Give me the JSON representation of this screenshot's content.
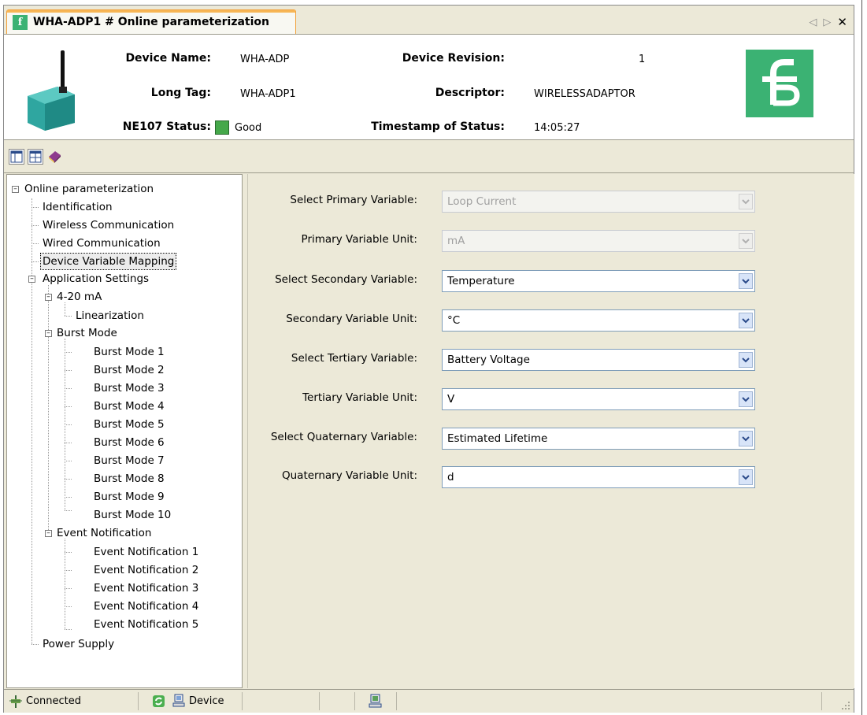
{
  "tab": {
    "title": "WHA-ADP1 # Online parameterization",
    "logo_glyph": "f"
  },
  "header": {
    "device_name_label": "Device Name:",
    "device_name": "WHA-ADP",
    "long_tag_label": "Long Tag:",
    "long_tag": "WHA-ADP1",
    "ne107_label": "NE107 Status:",
    "ne107_value": "Good",
    "device_revision_label": "Device Revision:",
    "device_revision": "1",
    "descriptor_label": "Descriptor:",
    "descriptor": "WIRELESSADAPTOR",
    "timestamp_label": "Timestamp of Status:",
    "timestamp": "14:05:27"
  },
  "tree": {
    "root": "Online parameterization",
    "identification": "Identification",
    "wireless": "Wireless Communication",
    "wired": "Wired Communication",
    "mapping": "Device Variable Mapping",
    "app_settings": "Application Settings",
    "ma": "4-20 mA",
    "linearization": "Linearization",
    "burst_mode": "Burst Mode",
    "burst_items": [
      "Burst Mode 1",
      "Burst Mode 2",
      "Burst Mode 3",
      "Burst Mode 4",
      "Burst Mode 5",
      "Burst Mode 6",
      "Burst Mode 7",
      "Burst Mode 8",
      "Burst Mode 9",
      "Burst Mode 10"
    ],
    "event_notification": "Event Notification",
    "event_items": [
      "Event Notification 1",
      "Event Notification 2",
      "Event Notification 3",
      "Event Notification 4",
      "Event Notification 5"
    ],
    "power_supply": "Power Supply"
  },
  "form": {
    "fields": [
      {
        "label": "Select Primary Variable:",
        "value": "Loop Current",
        "enabled": false
      },
      {
        "label": "Primary Variable Unit:",
        "value": "mA",
        "enabled": false
      },
      {
        "label": "Select Secondary Variable:",
        "value": "Temperature",
        "enabled": true
      },
      {
        "label": "Secondary Variable Unit:",
        "value": "°C",
        "enabled": true
      },
      {
        "label": "Select Tertiary Variable:",
        "value": "Battery Voltage",
        "enabled": true
      },
      {
        "label": "Tertiary Variable Unit:",
        "value": "V",
        "enabled": true
      },
      {
        "label": "Select Quaternary Variable:",
        "value": "Estimated Lifetime",
        "enabled": true
      },
      {
        "label": "Quaternary Variable Unit:",
        "value": "d",
        "enabled": true
      }
    ]
  },
  "statusbar": {
    "connection": "Connected",
    "device": "Device"
  },
  "colors": {
    "brand_green": "#3bb273",
    "status_good": "#45a84a",
    "tab_accent": "#f2a03a"
  }
}
